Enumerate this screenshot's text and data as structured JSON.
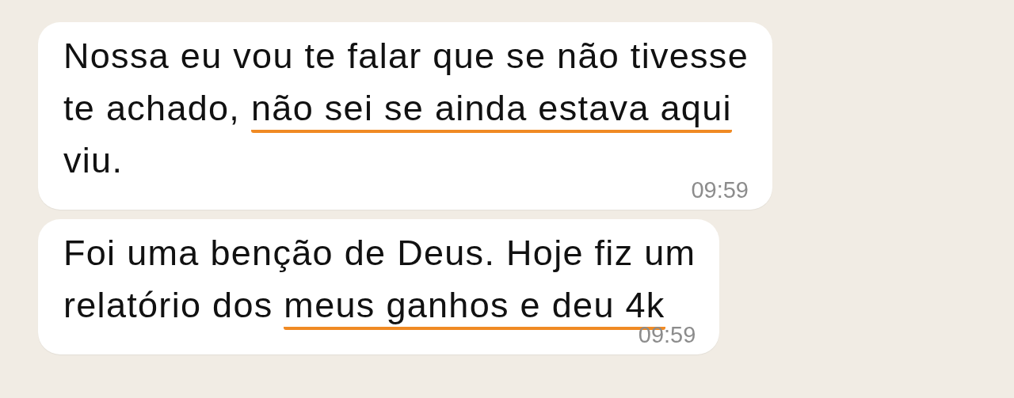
{
  "messages": [
    {
      "lines": [
        [
          {
            "text": "Nossa eu vou te falar que se não tivesse",
            "underlined": false
          }
        ],
        [
          {
            "text": "te achado, ",
            "underlined": false
          },
          {
            "text": "não sei se ainda estava aqui",
            "underlined": true
          }
        ],
        [
          {
            "text": "viu.",
            "underlined": false
          }
        ]
      ],
      "time": "09:59"
    },
    {
      "lines": [
        [
          {
            "text": "Foi uma benção de Deus. Hoje fiz um",
            "underlined": false
          }
        ],
        [
          {
            "text": "relatório dos ",
            "underlined": false
          },
          {
            "text": "meus ganhos e deu 4k",
            "underlined": true
          }
        ]
      ],
      "time": "09:59"
    }
  ]
}
